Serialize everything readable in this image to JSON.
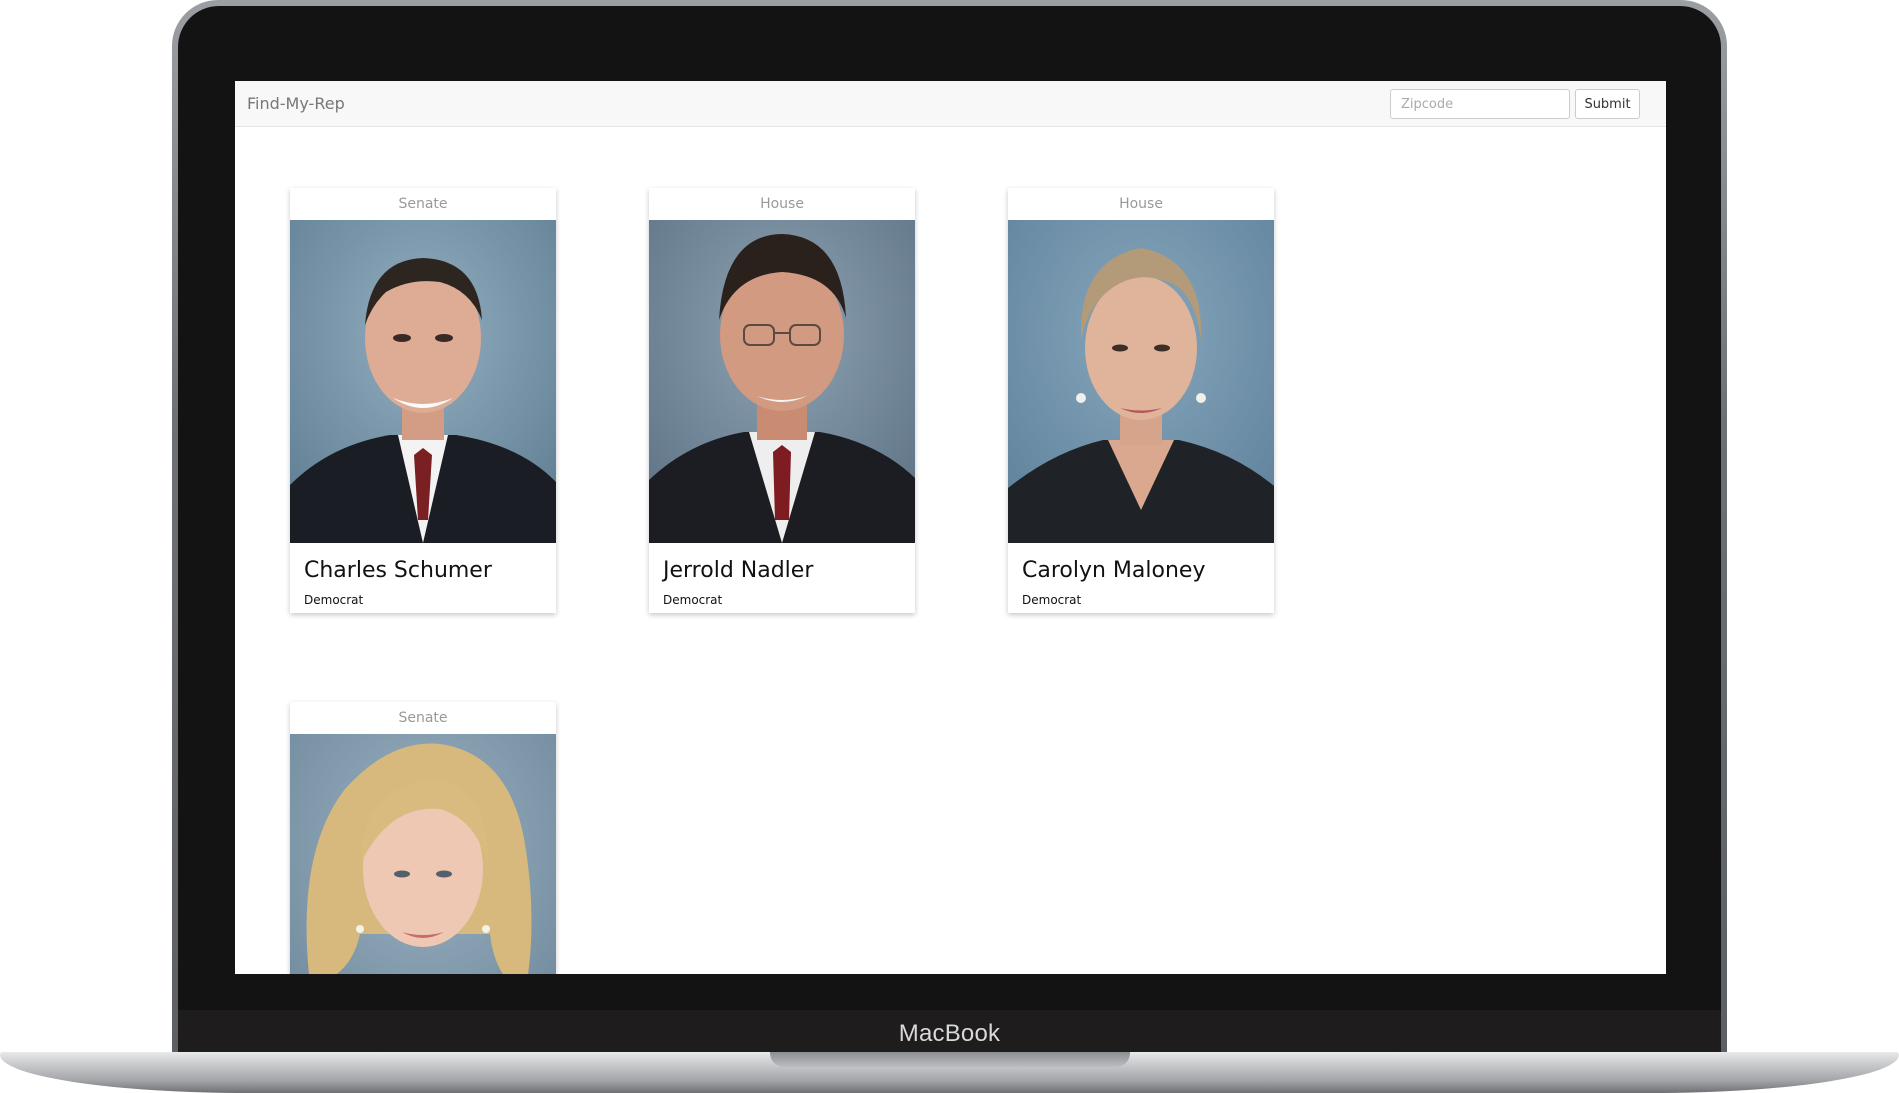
{
  "device": {
    "brand": "MacBook"
  },
  "navbar": {
    "brand": "Find-My-Rep",
    "zip_placeholder": "Zipcode",
    "submit_label": "Submit"
  },
  "reps": [
    {
      "chamber": "Senate",
      "name": "Charles Schumer",
      "party": "Democrat"
    },
    {
      "chamber": "House",
      "name": "Jerrold Nadler",
      "party": "Democrat"
    },
    {
      "chamber": "House",
      "name": "Carolyn Maloney",
      "party": "Democrat"
    },
    {
      "chamber": "Senate",
      "name": "",
      "party": ""
    }
  ],
  "colors": {
    "photo_backdrop": "#7d9aaf",
    "navbar_bg": "#f8f8f8"
  }
}
